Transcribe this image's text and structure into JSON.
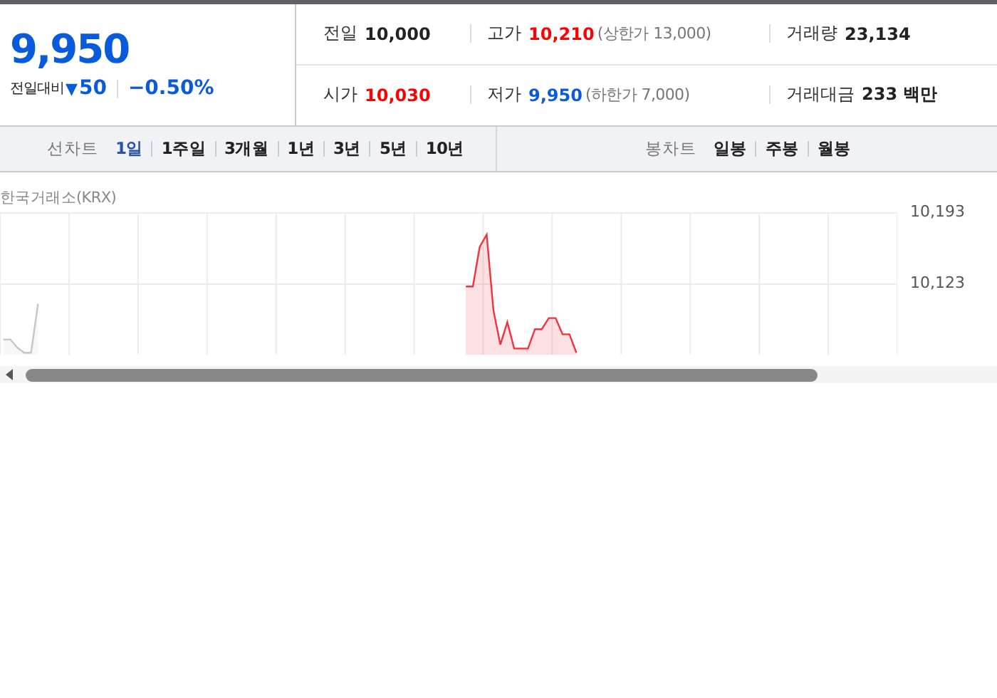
{
  "quote": {
    "price": "9,950",
    "change_label": "전일대비",
    "arrow": "▼",
    "change": "50",
    "change_rate": "−0.50%"
  },
  "stats": [
    {
      "label": "전일",
      "value": "10,000",
      "color": "#222222"
    },
    {
      "label": "고가",
      "value": "10,210",
      "color": "#ff0000",
      "note": "(상한가 13,000)"
    },
    {
      "label": "거래량",
      "value": "23,134",
      "color": "#222222"
    },
    {
      "label": "시가",
      "value": "10,030",
      "color": "#ff0000"
    },
    {
      "label": "저가",
      "value": "9,950",
      "color": "#0a5adc",
      "note": "(하한가 7,000)"
    },
    {
      "label": "거래대금",
      "value": "233 백만",
      "color": "#222222"
    }
  ],
  "line_chart_tabs": {
    "label": "선차트",
    "items": [
      {
        "label": "1일",
        "selected": true
      },
      {
        "label": "1주일",
        "selected": false
      },
      {
        "label": "3개월",
        "selected": false
      },
      {
        "label": "1년",
        "selected": false
      },
      {
        "label": "3년",
        "selected": false
      },
      {
        "label": "5년",
        "selected": false
      },
      {
        "label": "10년",
        "selected": false
      }
    ]
  },
  "candle_tabs": {
    "label": "봉차트",
    "items": [
      {
        "label": "일봉",
        "selected": false
      },
      {
        "label": "주봉",
        "selected": false
      },
      {
        "label": "월봉",
        "selected": false
      }
    ]
  },
  "chart": {
    "market": "한국거래소(KRX)",
    "chart_data": {
      "type": "area",
      "ylim": [
        10053,
        10193
      ],
      "yticks": [
        {
          "value": 10193,
          "label": "10,193"
        },
        {
          "value": 10123,
          "label": "10,123"
        }
      ],
      "categories": [
        null,
        null,
        null,
        null,
        null,
        null,
        null,
        null,
        null,
        null,
        null,
        null,
        null,
        null,
        null,
        null,
        null,
        null,
        null,
        null,
        null,
        null,
        null,
        null,
        null,
        null,
        null,
        null,
        null,
        null,
        null,
        null,
        null,
        null,
        null,
        null,
        null,
        null,
        null,
        null,
        null,
        null,
        null,
        null,
        null,
        null,
        null,
        null,
        null,
        null,
        null,
        null,
        null,
        null,
        null,
        null,
        null,
        null,
        null,
        null,
        null,
        null,
        null,
        null,
        null,
        null,
        null,
        null,
        null,
        null,
        null,
        null,
        null,
        null,
        null,
        null,
        null,
        null,
        null,
        null,
        null,
        null,
        null,
        null,
        null,
        null,
        null,
        null,
        null,
        null,
        null,
        null,
        null,
        null,
        null,
        null,
        null,
        null,
        null,
        null,
        null,
        null,
        null,
        null,
        null,
        null,
        null,
        null,
        null,
        null,
        null,
        null,
        null,
        null,
        null,
        null,
        null,
        null,
        null,
        null,
        null,
        null,
        null,
        null,
        null,
        null,
        null,
        null,
        null,
        null
      ],
      "series": [
        {
          "color": "#c4c6cc",
          "values": [
            10068,
            10068,
            10060,
            10055,
            10055,
            10103,
            null,
            null,
            null,
            null,
            null,
            null,
            null,
            null,
            null,
            null,
            null,
            null,
            null,
            null,
            null,
            null,
            null,
            null,
            null,
            null,
            null,
            null,
            null,
            null,
            null,
            null,
            null,
            null,
            null,
            null,
            null,
            null,
            null,
            null,
            null,
            null,
            null,
            null,
            null,
            null,
            null,
            null,
            null,
            null,
            null,
            null,
            null,
            null,
            null,
            null,
            null,
            null,
            null,
            null,
            null,
            null,
            null,
            null,
            null,
            null,
            null,
            null,
            null,
            null,
            null,
            null,
            null,
            null,
            null,
            null,
            null,
            null,
            null,
            null,
            null,
            null,
            null,
            null,
            null,
            null,
            null,
            null,
            null,
            null,
            null,
            null,
            null,
            null,
            null,
            null,
            null,
            null,
            null,
            null,
            null,
            null,
            null,
            null,
            null,
            null,
            null,
            null,
            null,
            null,
            null,
            null,
            null,
            null,
            null,
            null,
            null,
            null,
            null,
            null,
            null,
            null,
            null,
            null,
            null,
            null,
            null,
            null,
            null,
            null
          ]
        },
        {
          "color": "#f0333f",
          "values": [
            null,
            null,
            null,
            null,
            null,
            null,
            null,
            null,
            null,
            null,
            null,
            null,
            null,
            null,
            null,
            null,
            null,
            null,
            null,
            null,
            null,
            null,
            null,
            null,
            null,
            null,
            null,
            null,
            null,
            null,
            null,
            null,
            null,
            null,
            null,
            null,
            null,
            null,
            null,
            null,
            null,
            null,
            null,
            null,
            null,
            null,
            null,
            null,
            null,
            null,
            null,
            null,
            null,
            null,
            null,
            null,
            null,
            null,
            null,
            null,
            null,
            null,
            null,
            null,
            null,
            null,
            null,
            10120,
            10120,
            10159,
            10171,
            10096,
            10063,
            10085,
            10059,
            10059,
            10059,
            10078,
            10078,
            10089,
            10089,
            10073,
            10073,
            10055,
            null,
            null,
            null,
            null,
            null,
            null,
            null,
            null,
            null,
            null,
            null,
            null,
            null,
            null,
            null,
            null,
            null,
            null,
            null,
            null,
            null,
            null,
            null,
            null,
            null,
            null,
            null,
            null,
            null,
            null,
            null,
            null,
            null,
            null,
            null,
            null,
            null,
            null,
            null,
            null,
            null,
            null,
            null,
            null,
            null,
            null
          ]
        }
      ]
    }
  }
}
